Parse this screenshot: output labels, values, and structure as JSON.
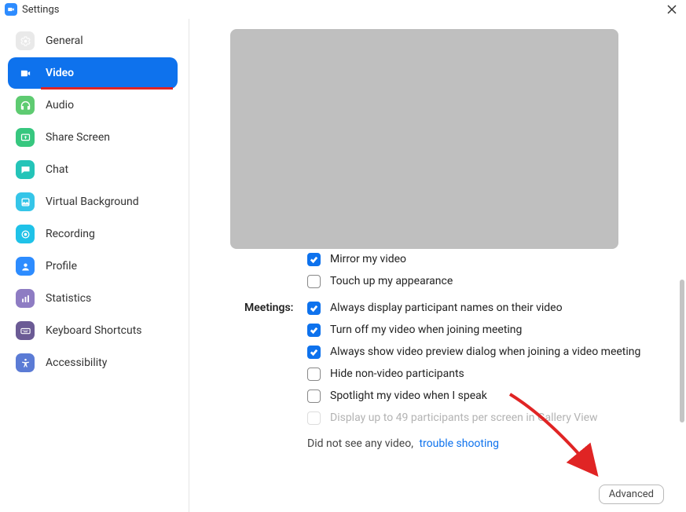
{
  "window": {
    "title": "Settings"
  },
  "sidebar": {
    "items": [
      {
        "label": "General"
      },
      {
        "label": "Video"
      },
      {
        "label": "Audio"
      },
      {
        "label": "Share Screen"
      },
      {
        "label": "Chat"
      },
      {
        "label": "Virtual Background"
      },
      {
        "label": "Recording"
      },
      {
        "label": "Profile"
      },
      {
        "label": "Statistics"
      },
      {
        "label": "Keyboard Shortcuts"
      },
      {
        "label": "Accessibility"
      }
    ]
  },
  "main": {
    "cutoff_option": "Mirror my video",
    "touchup": "Touch up my appearance",
    "section_meetings": "Meetings:",
    "opt1": "Always display participant names on their video",
    "opt2": "Turn off my video when joining meeting",
    "opt3": "Always show video preview dialog when joining a video meeting",
    "opt4": "Hide non-video participants",
    "opt5": "Spotlight my video when I speak",
    "opt6": "Display up to 49 participants per screen in Gallery View",
    "noVideoText": "Did not see any video,",
    "troubleshoot": "trouble shooting",
    "advanced": "Advanced"
  }
}
